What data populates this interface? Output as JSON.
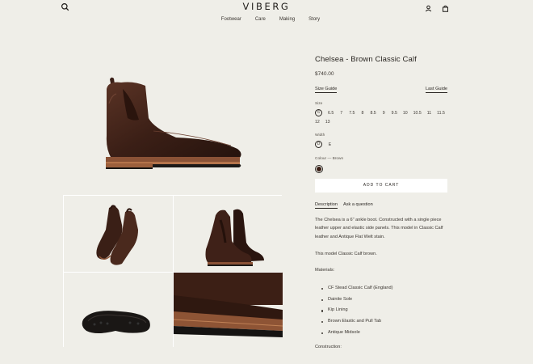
{
  "header": {
    "logo": "VIBERG",
    "nav": [
      "Footwear",
      "Care",
      "Making",
      "Story"
    ]
  },
  "product": {
    "title": "Chelsea - Brown Classic Calf",
    "price": "$740.00",
    "size_guide": "Size Guide",
    "last_guide": "Last Guide",
    "size_label": "Size",
    "sizes": [
      "6",
      "6.5",
      "7",
      "7.5",
      "8",
      "8.5",
      "9",
      "9.5",
      "10",
      "10.5",
      "11",
      "11.5",
      "12",
      "13"
    ],
    "selected_size": "6",
    "width_label": "Width",
    "widths": [
      "D",
      "E"
    ],
    "selected_width": "D",
    "colour_label": "Colour — Brown",
    "swatch_color": "#3a1f16",
    "add_to_cart": "ADD TO CART",
    "tabs": [
      "Description",
      "Ask a question"
    ],
    "description": [
      "The Chelsea is a 6\" ankle boot. Constructed with a single piece leather upper and elastic side panels. This model in Classic Calf leather and Antique Flat Welt stain.",
      "This model Classic Calf brown.",
      "Materials:"
    ],
    "materials": [
      "CF Stead Classic Calf (England)",
      "Dainite Sole",
      "Kip Lining",
      "Brown Elastic and Pull Tab",
      "Antique Midsole"
    ],
    "construction_label": "Construction:"
  },
  "colors": {
    "background": "#efeee8",
    "leather": "#3a1f16",
    "text": "#2a2622"
  }
}
